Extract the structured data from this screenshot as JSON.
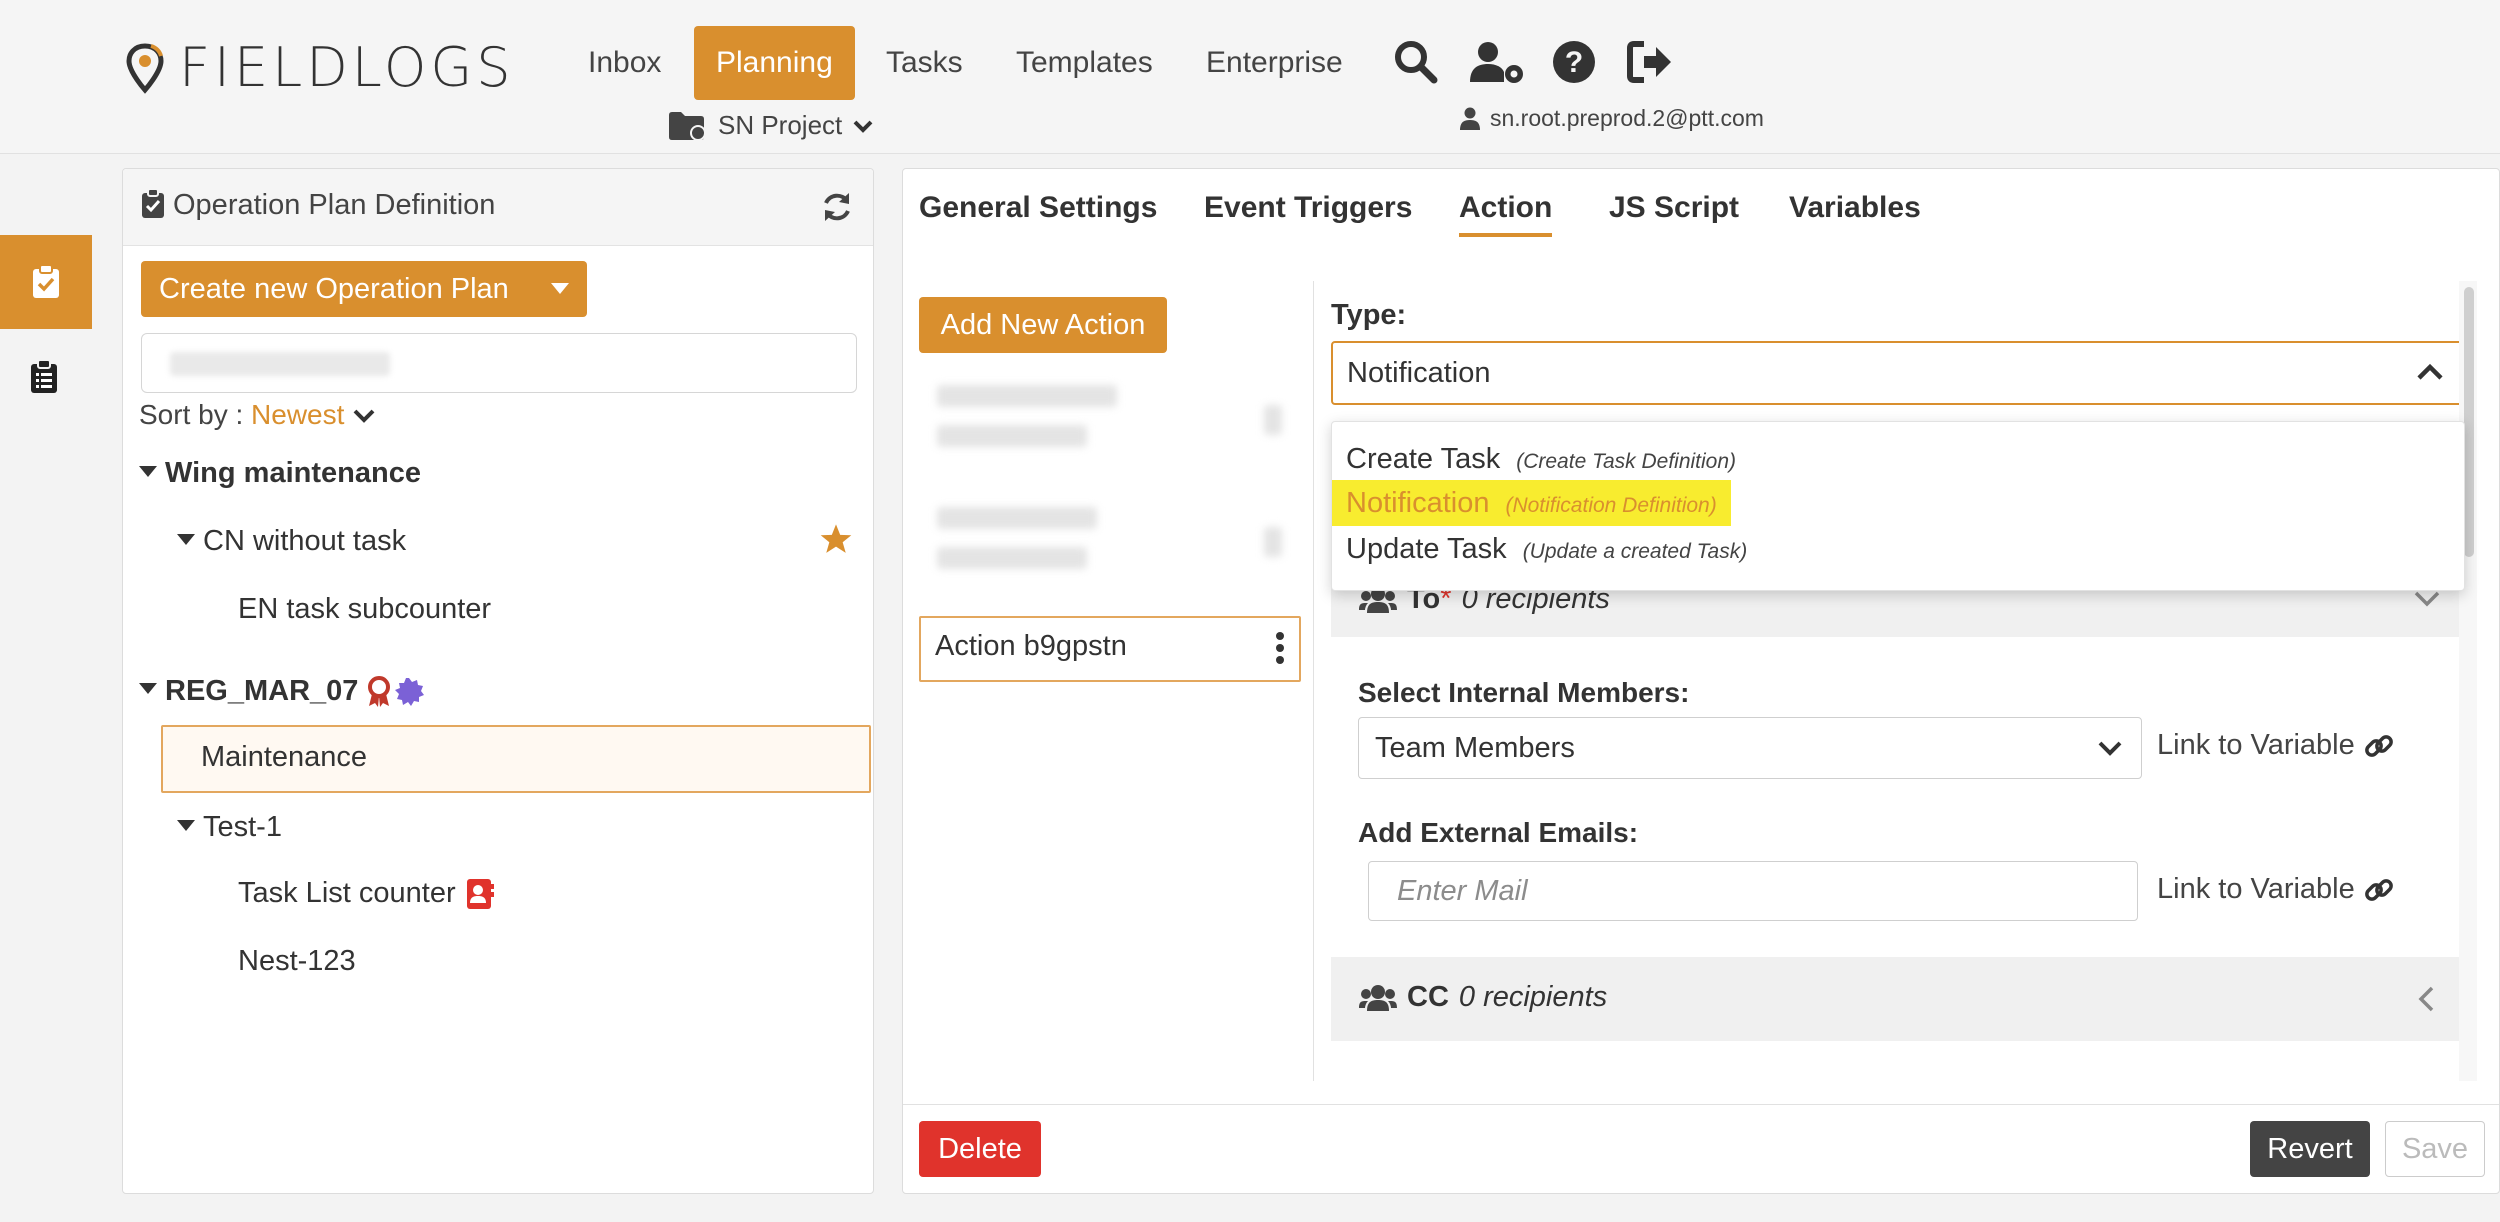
{
  "app": {
    "logo_text": "FIELDLOGS",
    "accent": "#d98f2e",
    "nav": [
      {
        "label": "Inbox"
      },
      {
        "label": "Planning"
      },
      {
        "label": "Tasks"
      },
      {
        "label": "Templates"
      },
      {
        "label": "Enterprise"
      }
    ],
    "project": "SN Project",
    "user_email": "sn.root.preprod.2@ptt.com",
    "header_icons": [
      "search-icon",
      "user-settings-icon",
      "help-icon",
      "logout-icon"
    ]
  },
  "left_panel": {
    "title": "Operation Plan Definition",
    "create_button": "Create new Operation Plan",
    "sort_label": "Sort by :",
    "sort_value": "Newest",
    "tree": [
      {
        "label": "Wing maintenance"
      },
      {
        "label": "CN without task"
      },
      {
        "label": "EN task subcounter"
      },
      {
        "label": "REG_MAR_07"
      },
      {
        "label": "Maintenance"
      },
      {
        "label": "Test-1"
      },
      {
        "label": "Task List counter"
      },
      {
        "label": "Nest-123"
      }
    ]
  },
  "right_panel": {
    "tabs": [
      "General Settings",
      "Event Triggers",
      "Action",
      "JS Script",
      "Variables"
    ],
    "active_tab": "Action",
    "add_action_button": "Add New Action",
    "selected_action": "Action b9gpstn",
    "type_label": "Type:",
    "type_value": "Notification",
    "type_options": [
      {
        "label": "Create Task",
        "hint": "(Create Task Definition)"
      },
      {
        "label": "Notification",
        "hint": "(Notification Definition)"
      },
      {
        "label": "Update Task",
        "hint": "(Update a created Task)"
      }
    ],
    "to_section": {
      "label": "To",
      "required": "*",
      "count": "0 recipients"
    },
    "internal_members_label": "Select Internal Members:",
    "internal_members_value": "Team Members",
    "link_to_variable": "Link to Variable",
    "external_emails_label": "Add External Emails:",
    "mail_placeholder": "Enter Mail",
    "cc_section": {
      "label": "CC",
      "count": "0 recipients"
    },
    "delete_button": "Delete",
    "revert_button": "Revert",
    "save_button": "Save"
  }
}
